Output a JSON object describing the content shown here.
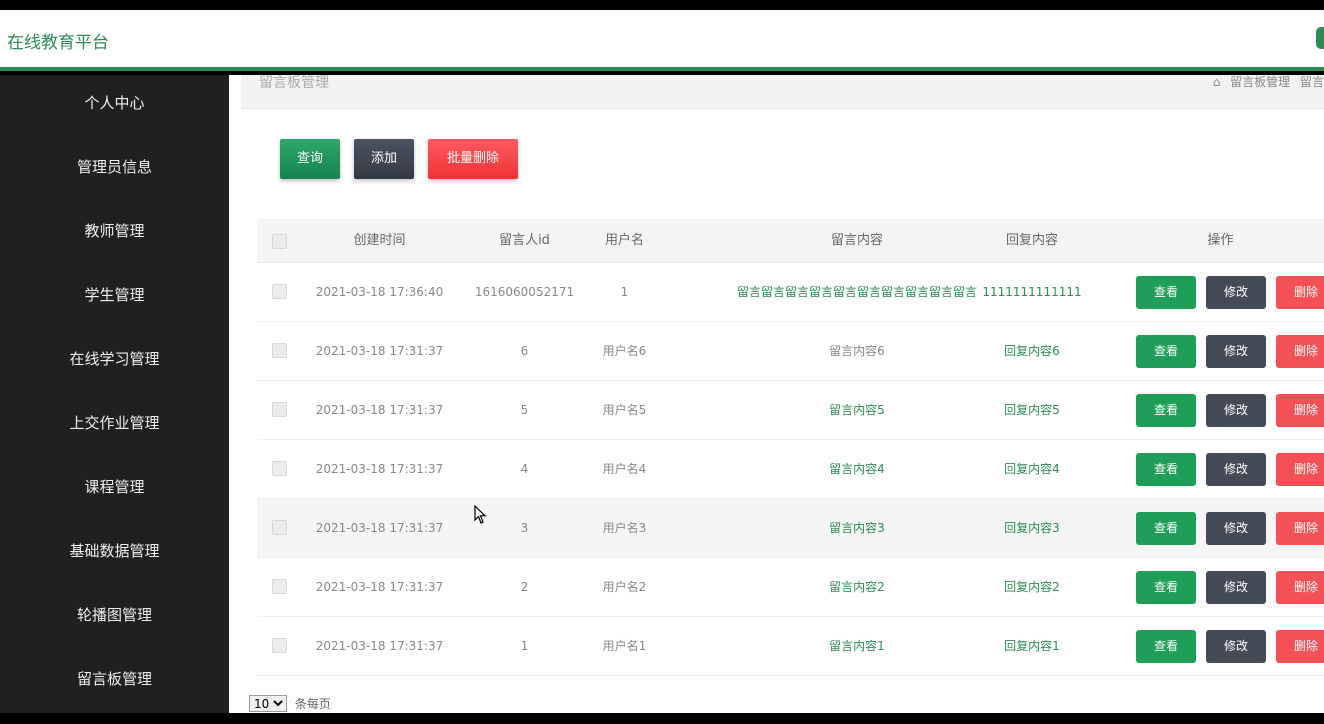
{
  "app": {
    "title": "在线教育平台",
    "accent_color": "#2e8b57"
  },
  "sidebar": {
    "items": [
      {
        "label": "个人中心"
      },
      {
        "label": "管理员信息"
      },
      {
        "label": "教师管理"
      },
      {
        "label": "学生管理"
      },
      {
        "label": "在线学习管理"
      },
      {
        "label": "上交作业管理"
      },
      {
        "label": "课程管理"
      },
      {
        "label": "基础数据管理"
      },
      {
        "label": "轮播图管理"
      },
      {
        "label": "留言板管理"
      }
    ]
  },
  "breadcrumb": {
    "title": "留言板管理",
    "icon": "home-icon",
    "path": [
      "留言板管理",
      "留言"
    ]
  },
  "toolbar": {
    "query_label": "查询",
    "add_label": "添加",
    "batch_delete_label": "批量删除"
  },
  "table": {
    "columns": [
      "创建时间",
      "留言人id",
      "用户名",
      "留言内容",
      "回复内容",
      "操作"
    ],
    "actions": {
      "view": "查看",
      "edit": "修改",
      "delete": "删除"
    },
    "rows": [
      {
        "created": "2021-03-18 17:36:40",
        "uid": "1616060052171",
        "username": "1",
        "content": "留言留言留言留言留言留言留言留言留言留言",
        "reply": "1111111111111"
      },
      {
        "created": "2021-03-18 17:31:37",
        "uid": "6",
        "username": "用户名6",
        "content": "留言内容6",
        "reply": "回复内容6"
      },
      {
        "created": "2021-03-18 17:31:37",
        "uid": "5",
        "username": "用户名5",
        "content": "留言内容5",
        "reply": "回复内容5"
      },
      {
        "created": "2021-03-18 17:31:37",
        "uid": "4",
        "username": "用户名4",
        "content": "留言内容4",
        "reply": "回复内容4"
      },
      {
        "created": "2021-03-18 17:31:37",
        "uid": "3",
        "username": "用户名3",
        "content": "留言内容3",
        "reply": "回复内容3"
      },
      {
        "created": "2021-03-18 17:31:37",
        "uid": "2",
        "username": "用户名2",
        "content": "留言内容2",
        "reply": "回复内容2"
      },
      {
        "created": "2021-03-18 17:31:37",
        "uid": "1",
        "username": "用户名1",
        "content": "留言内容1",
        "reply": "回复内容1"
      }
    ]
  },
  "pagination": {
    "page_size": "10",
    "suffix": "条每页"
  }
}
